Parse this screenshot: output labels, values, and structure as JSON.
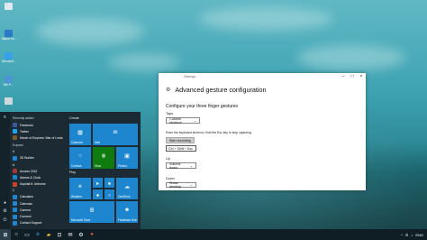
{
  "desktop": {
    "icons": [
      {
        "label": "",
        "color": "#dfe9f0",
        "icon": "recycle-bin-icon"
      },
      {
        "label": "Mauro Hu...",
        "color": "#2c79c9",
        "icon": "user-folder-icon"
      },
      {
        "label": "Microsoft...",
        "color": "#3aa0e8",
        "icon": "app-shortcut-icon"
      },
      {
        "label": "Win P...",
        "color": "#4d93d6",
        "icon": "computer-icon"
      },
      {
        "label": "",
        "color": "#cfd8dc",
        "icon": "file-icon"
      }
    ]
  },
  "start_menu": {
    "recently_added_label": "Recently added",
    "expand_label": "Expand",
    "recent_apps": [
      {
        "label": "Facebook",
        "color": "#3b5998"
      },
      {
        "label": "Twitter",
        "color": "#1da1f2"
      },
      {
        "label": "March of Empires: War of Lords",
        "color": "#7a5a2b"
      }
    ],
    "apps": [
      {
        "label": "#",
        "color": "#1b2a33",
        "is_header": true
      },
      {
        "label": "3D Builder",
        "color": "#1d86cf"
      },
      {
        "label": "A",
        "color": "#1b2a33",
        "is_header": true
      },
      {
        "label": "Access 2016",
        "color": "#a4373a"
      },
      {
        "label": "Alarms & Clock",
        "color": "#1d86cf"
      },
      {
        "label": "Asphalt 8: Airborne",
        "color": "#c9442c"
      },
      {
        "label": "C",
        "color": "#1b2a33",
        "is_header": true
      },
      {
        "label": "Calculator",
        "color": "#1d86cf"
      },
      {
        "label": "Calendar",
        "color": "#1d86cf"
      },
      {
        "label": "Camera",
        "color": "#1d86cf"
      },
      {
        "label": "Connect",
        "color": "#1d86cf"
      },
      {
        "label": "Contact Support",
        "color": "#1d86cf"
      }
    ],
    "create_label": "Create",
    "play_label": "Play",
    "tiles": {
      "calendar": "Calendar",
      "mail": "Mail",
      "cortana": "Cortana",
      "xbox": "Xbox",
      "photos": "Photos",
      "weather": "Weather",
      "onedrive": "OneDrive",
      "store": "Microsoft Store",
      "feedback": "Feedback Hub"
    },
    "tile_color": "#1d86cf"
  },
  "settings_window": {
    "title": "Settings",
    "heading": "Advanced gesture configuration",
    "subheading": "Configure your three finger gestures",
    "taps_label": "Taps",
    "taps_value": "Custom shortcut",
    "instruction": "Enter the keyboard shortcut. Hold the Esc key to stop capturing.",
    "start_recording": "Start recording",
    "shortcut_value": "Ctrl + Shift + Esc",
    "up_label": "Up",
    "up_value": "Volume down",
    "down_label": "Down",
    "down_value": "Show desktop"
  },
  "taskbar": {
    "items": [
      "windows-logo-icon",
      "search-icon",
      "task-view-icon",
      "edge-icon",
      "file-explorer-icon",
      "store-icon",
      "mail-icon",
      "settings-icon"
    ],
    "tray": [
      "^",
      "⊡",
      "♪",
      "ENG"
    ]
  }
}
